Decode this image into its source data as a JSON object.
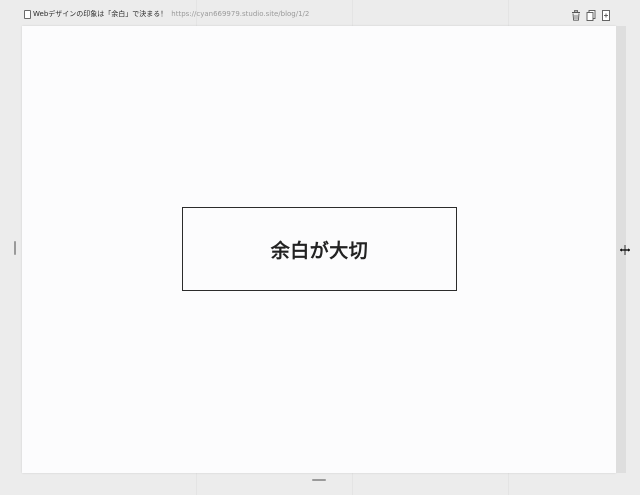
{
  "window": {
    "title": "Webデザインの印象は「余白」で決まる！",
    "url": "https://cyan669979.studio.site/blog/1/2"
  },
  "toolbar": {
    "icons": [
      "trash-icon",
      "copy-page-icon",
      "add-page-icon"
    ]
  },
  "canvas": {
    "heading": "余白が大切"
  },
  "colors": {
    "background": "#ececec",
    "canvas": "#fcfcfd",
    "border": "#2b2b2b",
    "text": "#222222"
  }
}
